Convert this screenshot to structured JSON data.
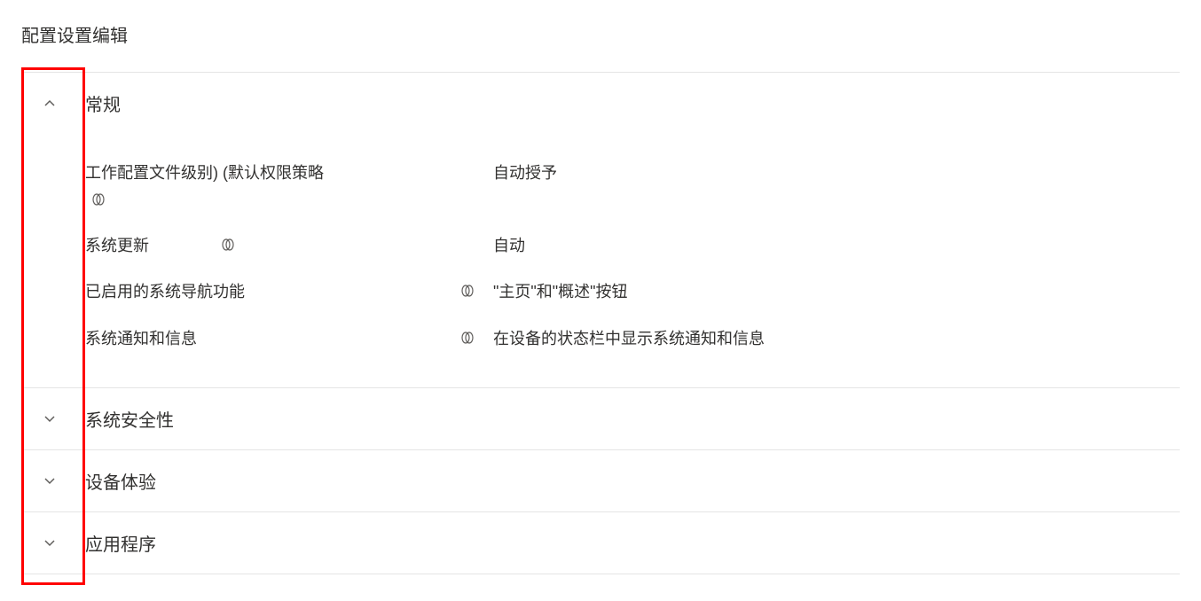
{
  "page": {
    "title": "配置设置编辑"
  },
  "sections": [
    {
      "label": "常规",
      "expanded": true,
      "settings": [
        {
          "label": "工作配置文件级别) (默认权限策略",
          "value": "自动授予",
          "icon_position": "inline"
        },
        {
          "label": "系统更新",
          "value": "自动",
          "icon_position": "after"
        },
        {
          "label": "已启用的系统导航功能",
          "value": "\"主页\"和\"概述\"按钮",
          "icon_position": "right"
        },
        {
          "label": "系统通知和信息",
          "value": "在设备的状态栏中显示系统通知和信息",
          "icon_position": "right"
        }
      ]
    },
    {
      "label": "系统安全性",
      "expanded": false
    },
    {
      "label": "设备体验",
      "expanded": false
    },
    {
      "label": "应用程序",
      "expanded": false
    }
  ]
}
